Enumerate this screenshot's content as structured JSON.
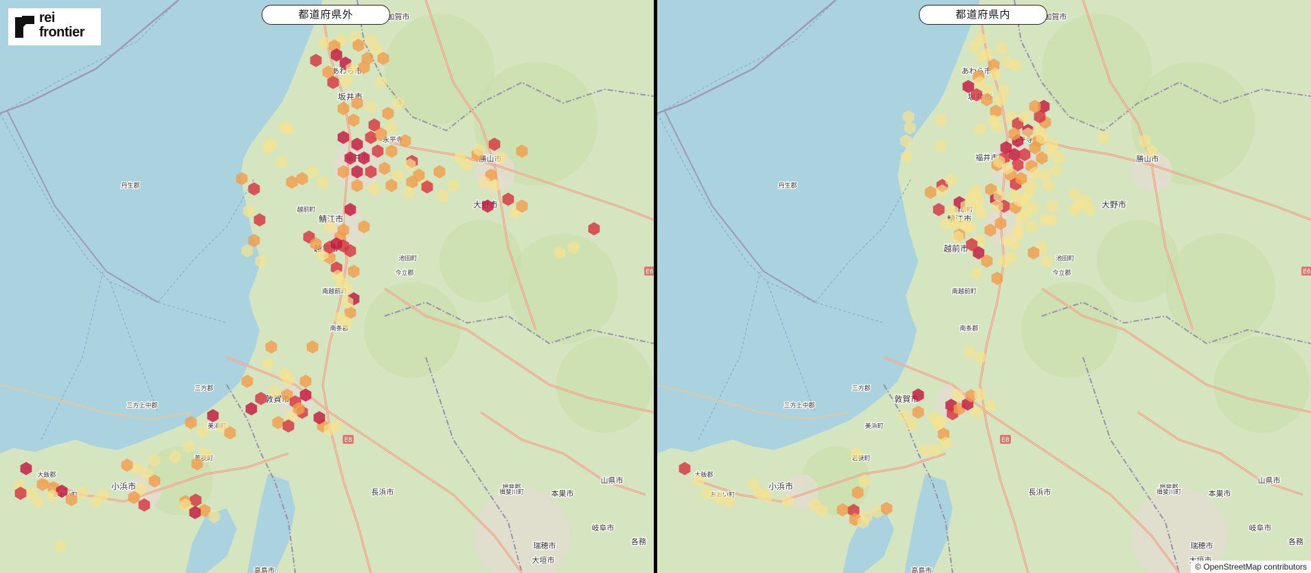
{
  "logo": {
    "line1": "rei",
    "line2": "frontier"
  },
  "panels": [
    {
      "id": "outside",
      "title": "都道府県外"
    },
    {
      "id": "inside",
      "title": "都道府県内"
    }
  ],
  "attribution": "© OpenStreetMap contributors",
  "place_labels": [
    "加賀市",
    "あわら市",
    "坂井市",
    "永平寺",
    "勝山市",
    "福井市",
    "大野市",
    "丹生郡",
    "越前町",
    "鯖江市",
    "越前市",
    "池田町",
    "今立郡",
    "南越前町",
    "南条郡",
    "三方郡",
    "三方上中郡",
    "美浜町",
    "敦賀市",
    "若狭町",
    "小浜市",
    "大飯郡",
    "おおい町",
    "長浜市",
    "揖斐郡",
    "揖斐川町",
    "本巣市",
    "山県市",
    "岐阜市",
    "瑞穂市",
    "大垣市",
    "各務",
    "高島市",
    "E8",
    "E6"
  ],
  "colors": {
    "sea": "#aad3df",
    "land": "#d4e5bf",
    "hex_low": "#f7e38e",
    "hex_mid": "#f29d4b",
    "hex_high": "#d8343f",
    "hex_top": "#c4173e"
  }
}
